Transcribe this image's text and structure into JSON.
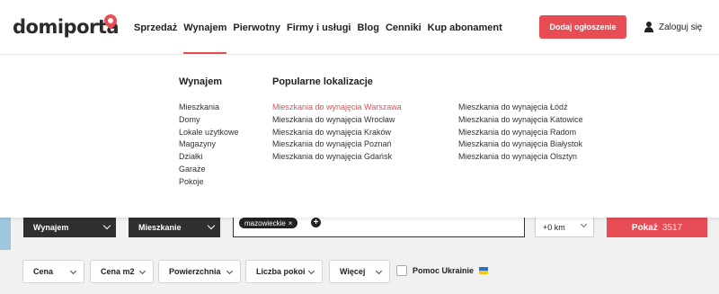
{
  "logo": {
    "text": "domiporta"
  },
  "nav": {
    "items": [
      "Sprzedaż",
      "Wynajem",
      "Pierwotny",
      "Firmy i usługi",
      "Blog",
      "Cenniki",
      "Kup abonament"
    ],
    "active": "Wynajem"
  },
  "header": {
    "cta_label": "Dodaj ogłoszenie",
    "login_label": "Zaloguj się"
  },
  "mega_menu": {
    "left_heading": "Wynajem",
    "left_items": [
      "Mieszkania",
      "Domy",
      "Lokale użytkowe",
      "Magazyny",
      "Działki",
      "Garaże",
      "Pokoje"
    ],
    "right_heading": "Popularne lokalizacje",
    "locations_col1": [
      "Mieszkania do wynajęcia Warszawa",
      "Mieszkania do wynajęcia Wrocław",
      "Mieszkania do wynajęcia Kraków",
      "Mieszkania do wynajęcia Poznań",
      "Mieszkania do wynajęcia Gdańsk"
    ],
    "locations_col2": [
      "Mieszkania do wynajęcia Łódź",
      "Mieszkania do wynajęcia Katowice",
      "Mieszkania do wynajęcia Radom",
      "Mieszkania do wynajęcia Białystok",
      "Mieszkania do wynajęcia Olsztyn"
    ]
  },
  "search": {
    "transaction": "Wynajem",
    "property_type": "Mieszkanie",
    "location_chip": "mazowieckie",
    "chip_remove": "×",
    "add_location": "+",
    "radius": "+0 km",
    "show_label": "Pokaż",
    "show_count": "3517"
  },
  "filters": {
    "items": [
      "Cena",
      "Cena m2",
      "Powierzchnia",
      "Liczba pokoi",
      "Więcej"
    ],
    "ukraine_label": "Pomoc Ukrainie"
  },
  "colors": {
    "accent": "#e84c55",
    "dark": "#2f2f2f",
    "flag_blue": "#2d6fc4",
    "flag_yellow": "#f5c518"
  }
}
